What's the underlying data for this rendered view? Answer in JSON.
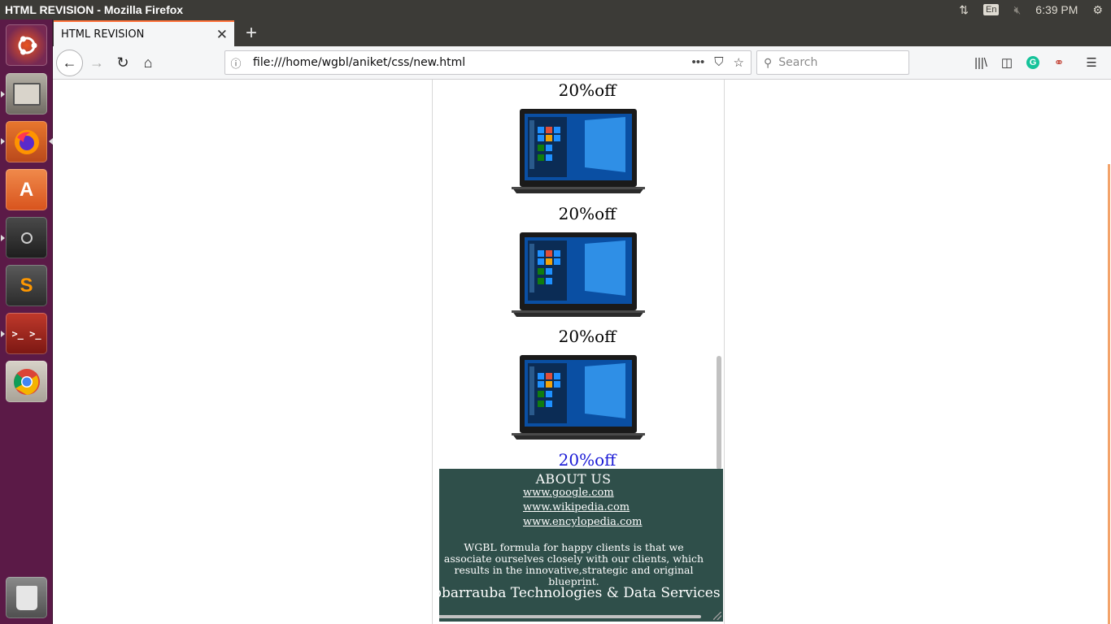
{
  "top_panel": {
    "window_title": "HTML REVISION - Mozilla Firefox",
    "keyboard_layout": "En",
    "clock": "6:39 PM"
  },
  "browser": {
    "tab_title": "HTML REVISION",
    "url": "file:///home/wgbl/aniket/css/new.html",
    "search_placeholder": "Search",
    "grammarly_letter": "G"
  },
  "launcher": {
    "apps": [
      "ubuntu-dash",
      "files",
      "firefox",
      "software-center",
      "system-settings",
      "sublime-text",
      "terminal",
      "chrome",
      "trash"
    ]
  },
  "page": {
    "products": [
      {
        "offer": "20%off"
      },
      {
        "offer": "20%off"
      },
      {
        "offer": "20%off"
      },
      {
        "offer": "20%off"
      }
    ],
    "footer": {
      "title": "ABOUT US",
      "links": [
        "www.google.com",
        "www.wikipedia.com",
        "www.encylopedia.com"
      ],
      "description": "WGBL formula for happy clients is that we associate ourselves closely with our clients, which results in the innovative,strategic and original blueprint.",
      "company": "Webbarrauba Technologies & Data Services Private Limited"
    }
  }
}
